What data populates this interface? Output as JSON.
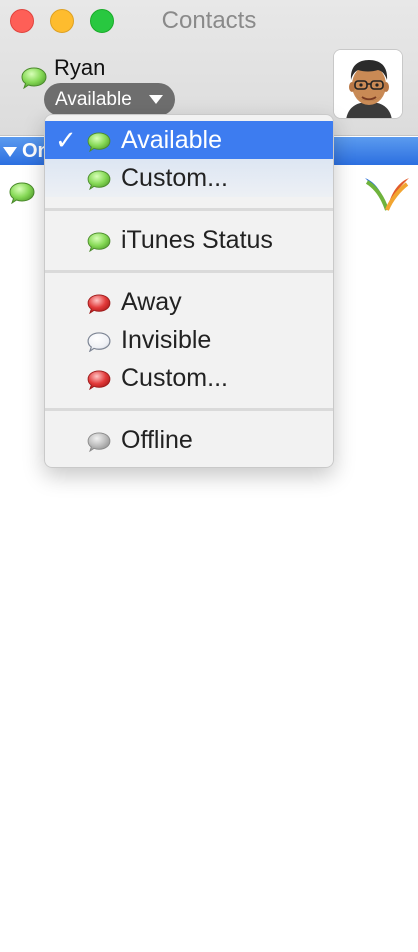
{
  "window": {
    "title": "Contacts"
  },
  "user": {
    "name": "Ryan",
    "status": "Available"
  },
  "group": {
    "label": "Online"
  },
  "status_menu": {
    "items": [
      {
        "label": "Available",
        "dot": "green",
        "checked": true
      },
      {
        "label": "Custom...",
        "dot": "green"
      },
      {
        "label": "iTunes Status",
        "dot": "green"
      },
      {
        "label": "Away",
        "dot": "red"
      },
      {
        "label": "Invisible",
        "dot": "clear"
      },
      {
        "label": "Custom...",
        "dot": "red"
      },
      {
        "label": "Offline",
        "dot": "gray"
      }
    ],
    "check_glyph": "✓"
  },
  "colors": {
    "selection": "#3d7cf0",
    "group_bar": "#2c6fe0",
    "status_green": "#7ed957",
    "status_red": "#e23a3a"
  },
  "icons": {
    "service": "x-service-icon",
    "avatar": "memoji-avatar-icon"
  }
}
